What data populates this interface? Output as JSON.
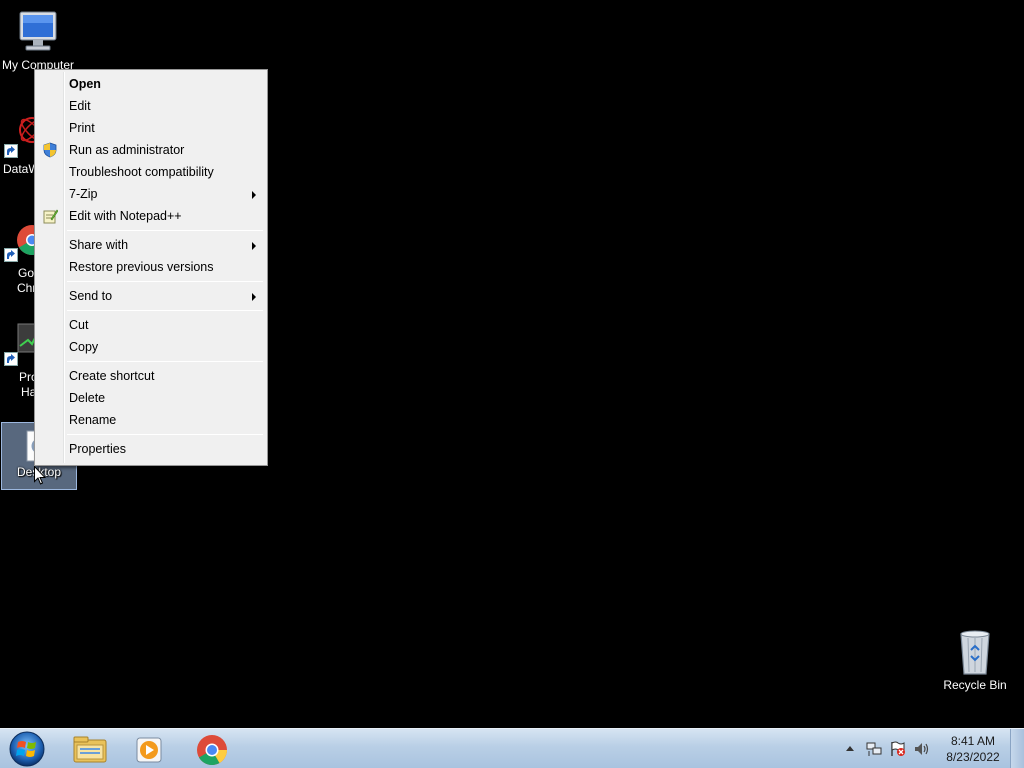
{
  "desktop": {
    "icons": {
      "my_computer": "My Computer",
      "datawrangler": "DataW",
      "chrome_line1": "Go",
      "chrome_line2": "Chr",
      "process_hacker_line1": "Pro",
      "process_hacker_line2": "Ha",
      "desktop_file": "Desktop",
      "recycle_bin": "Recycle Bin"
    }
  },
  "context_menu": {
    "items": [
      {
        "label": "Open",
        "bold": true
      },
      {
        "label": "Edit"
      },
      {
        "label": "Print"
      },
      {
        "label": "Run as administrator",
        "icon": "uac-shield-icon"
      },
      {
        "label": "Troubleshoot compatibility"
      },
      {
        "label": "7-Zip",
        "submenu": true
      },
      {
        "label": "Edit with Notepad++",
        "icon": "notepadpp-icon"
      },
      {
        "label": "Share with",
        "submenu": true
      },
      {
        "label": "Restore previous versions"
      },
      {
        "label": "Send to",
        "submenu": true
      },
      {
        "label": "Cut"
      },
      {
        "label": "Copy"
      },
      {
        "label": "Create shortcut"
      },
      {
        "label": "Delete"
      },
      {
        "label": "Rename"
      },
      {
        "label": "Properties"
      }
    ]
  },
  "taskbar": {
    "pinned": [
      "windows-explorer-icon",
      "media-player-icon",
      "chrome-icon"
    ],
    "clock": {
      "time": "8:41 AM",
      "date": "8/23/2022"
    }
  },
  "colors": {
    "desktop_bg": "#000000",
    "menu_bg": "#f0f0f0",
    "taskbar_accent": "#b9cfe6"
  }
}
